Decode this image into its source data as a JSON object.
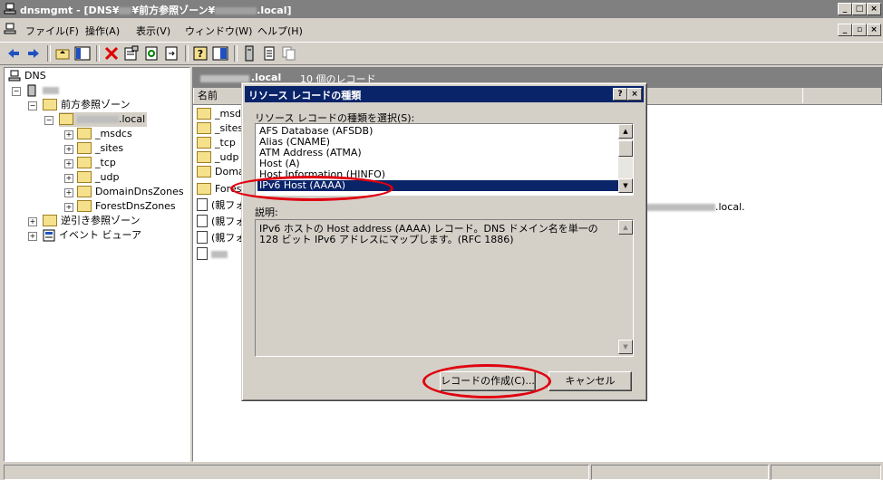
{
  "window": {
    "title": "dnsmgmt - [DNS¥",
    "title_mid": "¥前方参照ゾーン¥",
    "title_end": ".local]",
    "minimize_label": "_",
    "maximize_label": "□",
    "close_label": "×",
    "mdi_min_label": "_",
    "mdi_restore_label": "▫",
    "mdi_close_label": "×"
  },
  "menu": {
    "file": "ファイル(F)",
    "action": "操作(A)",
    "view": "表示(V)",
    "window": "ウィンドウ(W)",
    "help": "ヘルプ(H)"
  },
  "tree": {
    "root": "DNS",
    "forward_zones": "前方参照ゾーン",
    "zone": ".local",
    "children": [
      "_msdcs",
      "_sites",
      "_tcp",
      "_udp",
      "DomainDnsZones",
      "ForestDnsZones"
    ],
    "reverse_zones": "逆引き参照ゾーン",
    "event_viewer": "イベント ビューア"
  },
  "right_pane": {
    "zone_title": ".local",
    "record_count": "10 個のレコード",
    "col_name": "名前",
    "rows": [
      "_msdc",
      "_sites",
      "_tcp",
      "_udp",
      "Doma",
      "Fores",
      "(親フォ",
      "(親フォ",
      "(親フォ"
    ],
    "row_right_text": ".local."
  },
  "dialog": {
    "title": "リソース レコードの種類",
    "help_label": "?",
    "close_label": "×",
    "select_label": "リソース レコードの種類を選択(S):",
    "options": [
      "AFS Database (AFSDB)",
      "Alias (CNAME)",
      "ATM Address (ATMA)",
      "Host (A)",
      "Host Information (HINFO)",
      "IPv6 Host (AAAA)"
    ],
    "selected_index": 5,
    "desc_label": "説明:",
    "description": "IPv6 ホストの Host address (AAAA) レコード。DNS ドメイン名を単一の 128 ビット IPv6 アドレスにマップします。(RFC 1886)",
    "create_button": "レコードの作成(C)...",
    "cancel_button": "キャンセル"
  },
  "colors": {
    "active_title": "#0a246a",
    "inactive_title": "#808080",
    "face": "#d4d0c8",
    "highlight_oval": "#e00010"
  }
}
